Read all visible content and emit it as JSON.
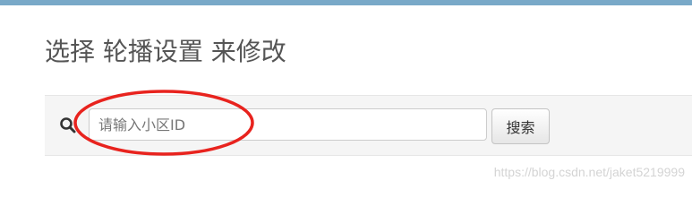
{
  "header": {
    "title": "选择 轮播设置 来修改"
  },
  "search": {
    "placeholder": "请输入小区ID",
    "value": "",
    "button_label": "搜索",
    "icon": "search-icon"
  },
  "annotation": {
    "shape": "ellipse",
    "color": "#e8231e"
  },
  "watermark": {
    "text": "https://blog.csdn.net/jaket5219999"
  },
  "colors": {
    "top_bar": "#79a9c8",
    "panel_background": "#f5f5f5"
  }
}
